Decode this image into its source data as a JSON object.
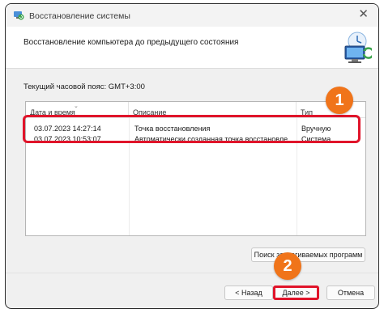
{
  "window": {
    "title": "Восстановление системы",
    "close_glyph": "✕"
  },
  "header": {
    "title": "Восстановление компьютера до предыдущего состояния"
  },
  "timezone_label": "Текущий часовой пояс: GMT+3:00",
  "table": {
    "columns": [
      "Дата и время",
      "Описание",
      "Тип"
    ],
    "sort_indicator": "⌄",
    "rows": [
      {
        "datetime": "03.07.2023 14:27:14",
        "description": "Точка восстановления",
        "type": "Вручную"
      },
      {
        "datetime": "03.07.2023 10:53:07",
        "description": "Автоматически созданная точка восстановле...",
        "type": "Система"
      }
    ]
  },
  "buttons": {
    "search": "Поиск затрагиваемых программ",
    "back": "< Назад",
    "next": "Далее >",
    "cancel": "Отмена"
  },
  "badges": {
    "one": "1",
    "two": "2",
    "color": "#f0741a"
  },
  "highlight_color": "#e0142a"
}
